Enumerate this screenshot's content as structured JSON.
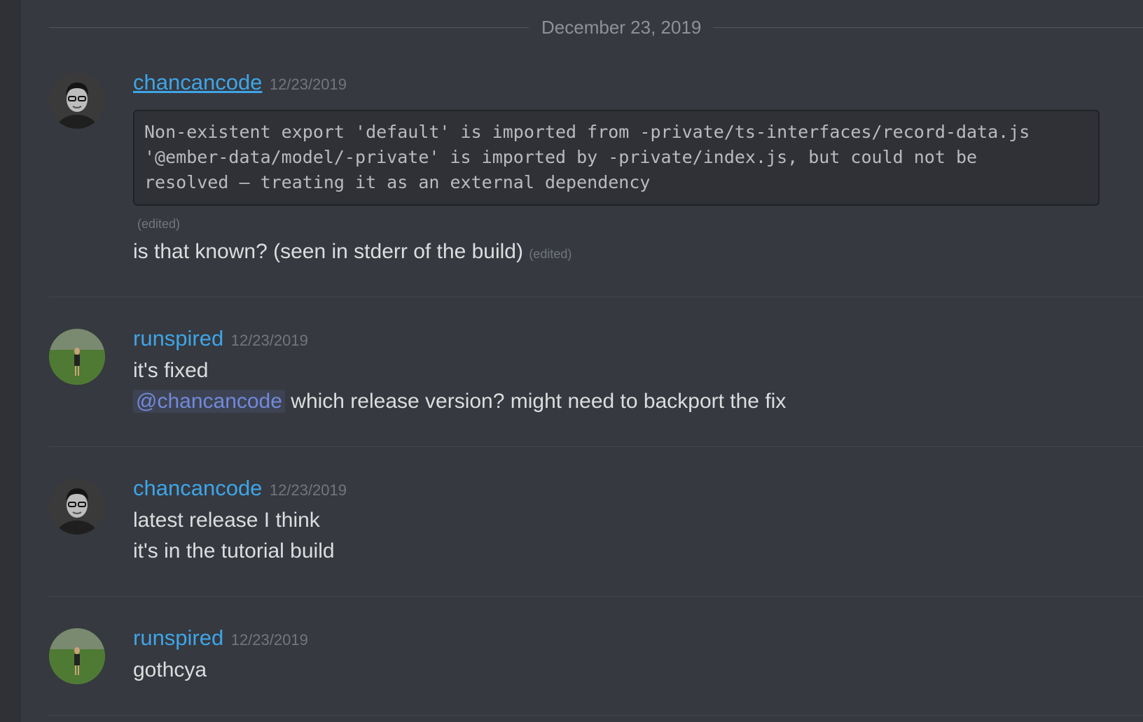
{
  "date_divider": "December 23, 2019",
  "messages": [
    {
      "username": "chancancode",
      "timestamp": "12/23/2019",
      "code_lines": [
        "Non-existent export 'default' is imported from -private/ts-interfaces/record-data.js",
        "'@ember-data/model/-private' is imported by -private/index.js, but could not be",
        "resolved – treating it as an external dependency"
      ],
      "edited_label": "(edited)",
      "text": "is that known? (seen in stderr of the build)",
      "text_edited_label": "(edited)"
    },
    {
      "username": "runspired",
      "timestamp": "12/23/2019",
      "line1": "it's fixed",
      "mention": "@chancancode",
      "line2": " which release version? might need to backport the fix"
    },
    {
      "username": "chancancode",
      "timestamp": "12/23/2019",
      "line1": "latest release I think",
      "line2": "it's in the tutorial build"
    },
    {
      "username": "runspired",
      "timestamp": "12/23/2019",
      "line1": "gothcya"
    }
  ],
  "colors": {
    "background": "#36393f",
    "username": "#3ea5e8",
    "text": "#dcddde",
    "timestamp": "#72767d",
    "mention": "#7289da",
    "code_bg": "#2f3136"
  }
}
